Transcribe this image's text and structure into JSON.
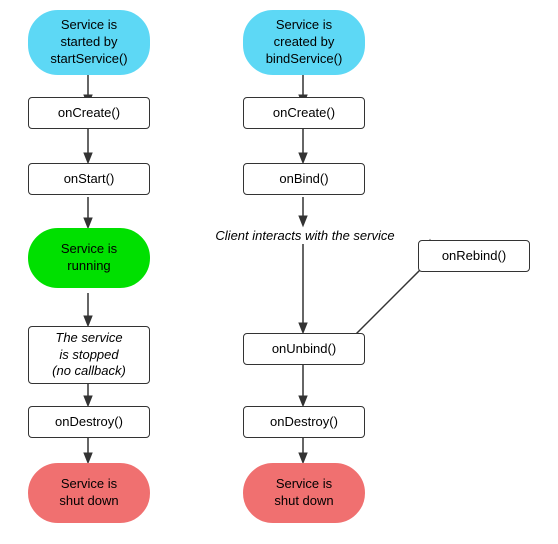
{
  "nodes": {
    "start_service": {
      "label": "Service is\nstarted by\nstartService()",
      "bg": "cyan"
    },
    "bind_service": {
      "label": "Service is\ncreated by\nbindService()",
      "bg": "cyan"
    },
    "left_oncreate": {
      "label": "onCreate()"
    },
    "right_oncreate": {
      "label": "onCreate()"
    },
    "onstart": {
      "label": "onStart()"
    },
    "onbind": {
      "label": "onBind()"
    },
    "service_running": {
      "label": "Service is\nrunning",
      "bg": "green"
    },
    "client_interacts": {
      "label": "Client interacts with the service",
      "italic": true
    },
    "onrebind": {
      "label": "onRebind()"
    },
    "service_stopped": {
      "label": "The service\nis stopped\n(no callback)",
      "italic": true
    },
    "onunbind": {
      "label": "onUnbind()"
    },
    "left_ondestroy": {
      "label": "onDestroy()"
    },
    "right_ondestroy": {
      "label": "onDestroy()"
    },
    "left_shutdown": {
      "label": "Service is\nshut down",
      "bg": "red"
    },
    "right_shutdown": {
      "label": "Service is\nshut down",
      "bg": "red"
    }
  }
}
